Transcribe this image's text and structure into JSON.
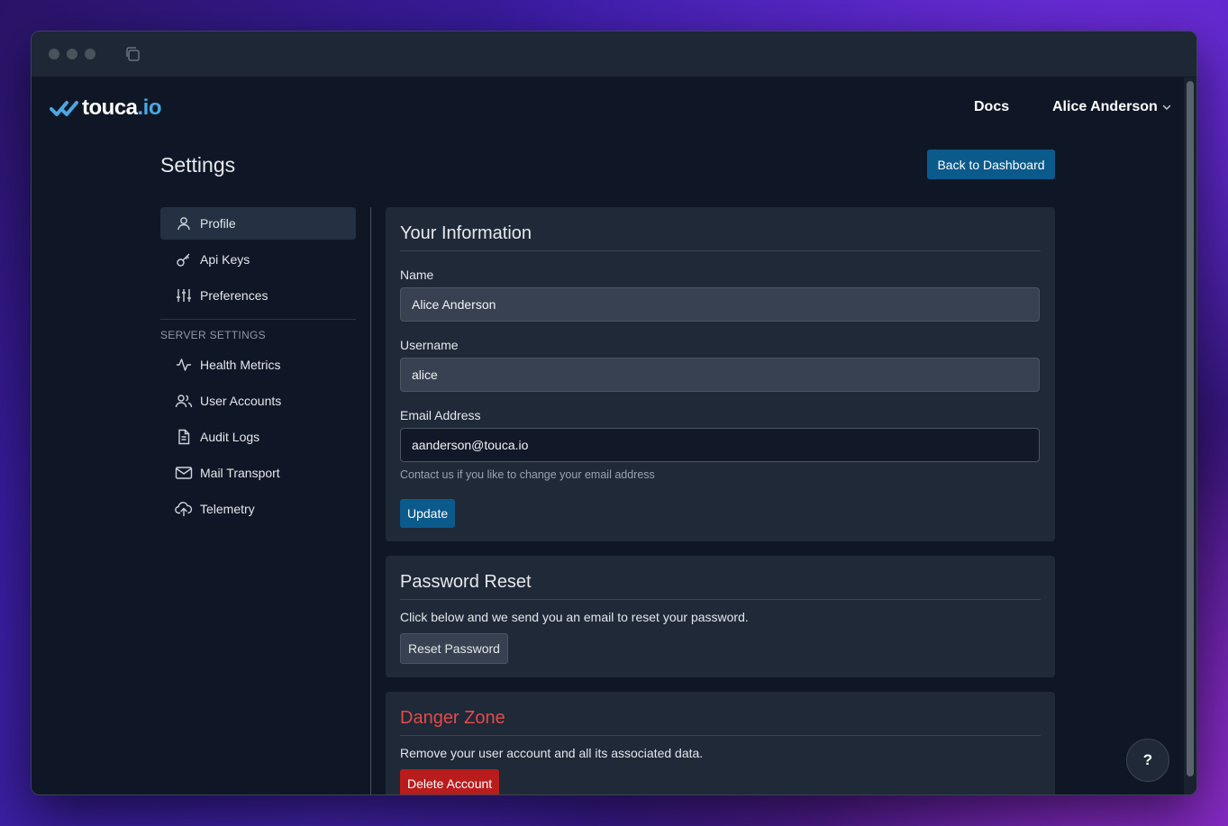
{
  "brand": {
    "name_main": "touca",
    "name_suffix": ".io",
    "accent": "#4aa8e0"
  },
  "nav": {
    "docs": "Docs",
    "user": "Alice Anderson"
  },
  "header": {
    "title": "Settings",
    "back_button": "Back to Dashboard"
  },
  "sidebar": {
    "items": [
      {
        "label": "Profile",
        "icon": "user-icon",
        "active": true
      },
      {
        "label": "Api Keys",
        "icon": "key-icon"
      },
      {
        "label": "Preferences",
        "icon": "sliders-icon"
      }
    ],
    "server_section_title": "SERVER SETTINGS",
    "server_items": [
      {
        "label": "Health Metrics",
        "icon": "activity-icon"
      },
      {
        "label": "User Accounts",
        "icon": "users-icon"
      },
      {
        "label": "Audit Logs",
        "icon": "document-icon"
      },
      {
        "label": "Mail Transport",
        "icon": "mail-icon"
      },
      {
        "label": "Telemetry",
        "icon": "cloud-upload-icon"
      }
    ]
  },
  "info_card": {
    "title": "Your Information",
    "name_label": "Name",
    "name_value": "Alice Anderson",
    "username_label": "Username",
    "username_value": "alice",
    "email_label": "Email Address",
    "email_value": "aanderson@touca.io",
    "email_hint": "Contact us if you like to change your email address",
    "update_button": "Update"
  },
  "password_card": {
    "title": "Password Reset",
    "text": "Click below and we send you an email to reset your password.",
    "button": "Reset Password"
  },
  "danger_card": {
    "title": "Danger Zone",
    "text": "Remove your user account and all its associated data.",
    "button": "Delete Account"
  },
  "help": {
    "label": "?"
  },
  "colors": {
    "primary": "#0b5a8c",
    "danger": "#b91c1c",
    "danger_text": "#e34b4b",
    "background": "#0f1726",
    "card": "#1f2937"
  }
}
